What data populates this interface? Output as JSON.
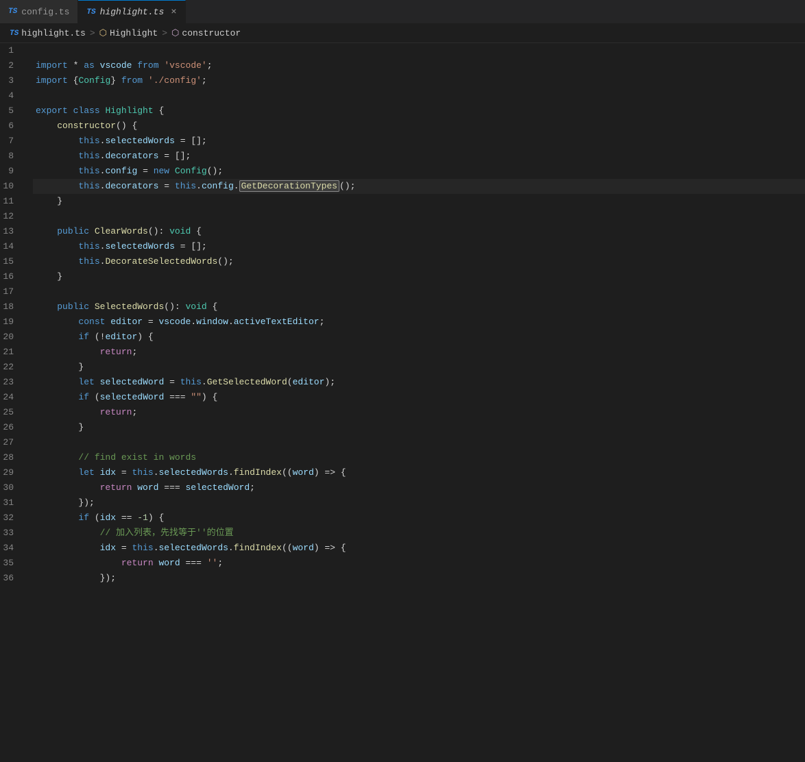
{
  "tabs": [
    {
      "id": "config",
      "label": "config.ts",
      "active": false,
      "modified": false
    },
    {
      "id": "highlight",
      "label": "highlight.ts",
      "active": true,
      "modified": false,
      "closeable": true
    }
  ],
  "breadcrumb": {
    "file": "highlight.ts",
    "class": "Highlight",
    "member": "constructor"
  },
  "lines": [
    {
      "num": 1,
      "tokens": []
    },
    {
      "num": 2,
      "code": "import * as vscode from 'vscode';"
    },
    {
      "num": 3,
      "code": "import {Config} from './config';"
    },
    {
      "num": 4,
      "tokens": []
    },
    {
      "num": 5,
      "code": "export class Highlight {"
    },
    {
      "num": 6,
      "code": "    constructor() {"
    },
    {
      "num": 7,
      "code": "        this.selectedWords = [];"
    },
    {
      "num": 8,
      "code": "        this.decorators = [];"
    },
    {
      "num": 9,
      "code": "        this.config = new Config();"
    },
    {
      "num": 10,
      "code": "        this.decorators = this.config.GetDecorationTypes();",
      "highlighted": true
    },
    {
      "num": 11,
      "code": "    }"
    },
    {
      "num": 12,
      "tokens": []
    },
    {
      "num": 13,
      "code": "    public ClearWords(): void {"
    },
    {
      "num": 14,
      "code": "        this.selectedWords = [];"
    },
    {
      "num": 15,
      "code": "        this.DecorateSelectedWords();"
    },
    {
      "num": 16,
      "code": "    }"
    },
    {
      "num": 17,
      "tokens": []
    },
    {
      "num": 18,
      "code": "    public SelectedWords(): void {"
    },
    {
      "num": 19,
      "code": "        const editor = vscode.window.activeTextEditor;"
    },
    {
      "num": 20,
      "code": "        if (!editor) {"
    },
    {
      "num": 21,
      "code": "            return;"
    },
    {
      "num": 22,
      "code": "        }"
    },
    {
      "num": 23,
      "code": "        let selectedWord = this.GetSelectedWord(editor);"
    },
    {
      "num": 24,
      "code": "        if (selectedWord === \"\") {"
    },
    {
      "num": 25,
      "code": "            return;"
    },
    {
      "num": 26,
      "code": "        }"
    },
    {
      "num": 27,
      "tokens": []
    },
    {
      "num": 28,
      "code": "        // find exist in words"
    },
    {
      "num": 29,
      "code": "        let idx = this.selectedWords.findIndex((word) => {"
    },
    {
      "num": 30,
      "code": "            return word === selectedWord;"
    },
    {
      "num": 31,
      "code": "        });"
    },
    {
      "num": 32,
      "code": "        if (idx == -1) {"
    },
    {
      "num": 33,
      "code": "            // 加入列表，先找等于''的位置"
    },
    {
      "num": 34,
      "code": "            idx = this.selectedWords.findIndex((word) => {"
    },
    {
      "num": 35,
      "code": "                return word === '';"
    },
    {
      "num": 36,
      "code": "            });"
    }
  ]
}
